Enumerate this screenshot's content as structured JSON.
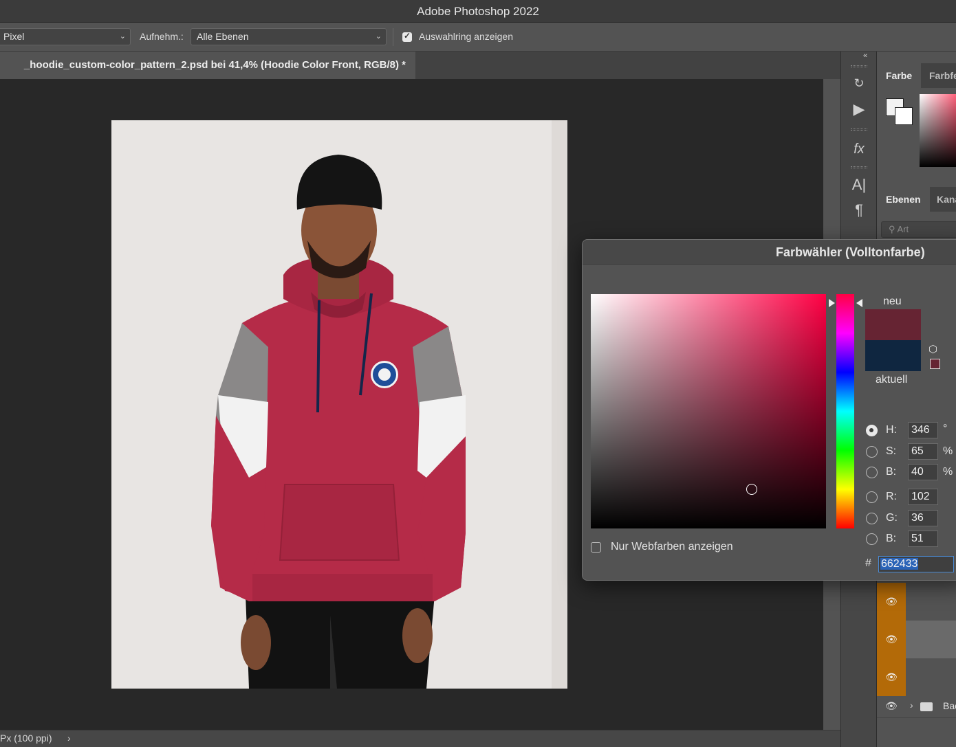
{
  "app": {
    "title": "Adobe Photoshop 2022"
  },
  "options_bar": {
    "sample_size": "Pixel",
    "sample_label": "Aufnehm.:",
    "sample_value": "Alle Ebenen",
    "show_ring_label": "Auswahlring anzeigen",
    "show_ring_checked": true
  },
  "document": {
    "tab_title": "_hoodie_custom-color_pattern_2.psd bei 41,4% (Hoodie Color Front, RGB/8) *",
    "status": "Px (100 ppi)"
  },
  "color_panel": {
    "tabs": [
      "Farbe",
      "Farbfe"
    ]
  },
  "layers_panel": {
    "tabs": [
      "Ebenen",
      "Kanä"
    ],
    "search_placeholder": "Art",
    "group_name": "Bac"
  },
  "color_picker": {
    "title": "Farbwähler (Volltonfarbe)",
    "new_label": "neu",
    "current_label": "aktuell",
    "new_color": "#662433",
    "current_color": "#0f2640",
    "fields": {
      "h": {
        "label": "H:",
        "value": "346",
        "unit": "°",
        "selected": true
      },
      "s": {
        "label": "S:",
        "value": "65",
        "unit": "%"
      },
      "b": {
        "label": "B:",
        "value": "40",
        "unit": "%"
      },
      "r": {
        "label": "R:",
        "value": "102"
      },
      "g": {
        "label": "G:",
        "value": "36"
      },
      "b2": {
        "label": "B:",
        "value": "51"
      }
    },
    "hex_symbol": "#",
    "hex": "662433",
    "web_colors_label": "Nur Webfarben anzeigen",
    "web_colors_checked": false
  },
  "colors": {
    "eye_column": "#b36a08",
    "hoodie": "#b52b48"
  }
}
